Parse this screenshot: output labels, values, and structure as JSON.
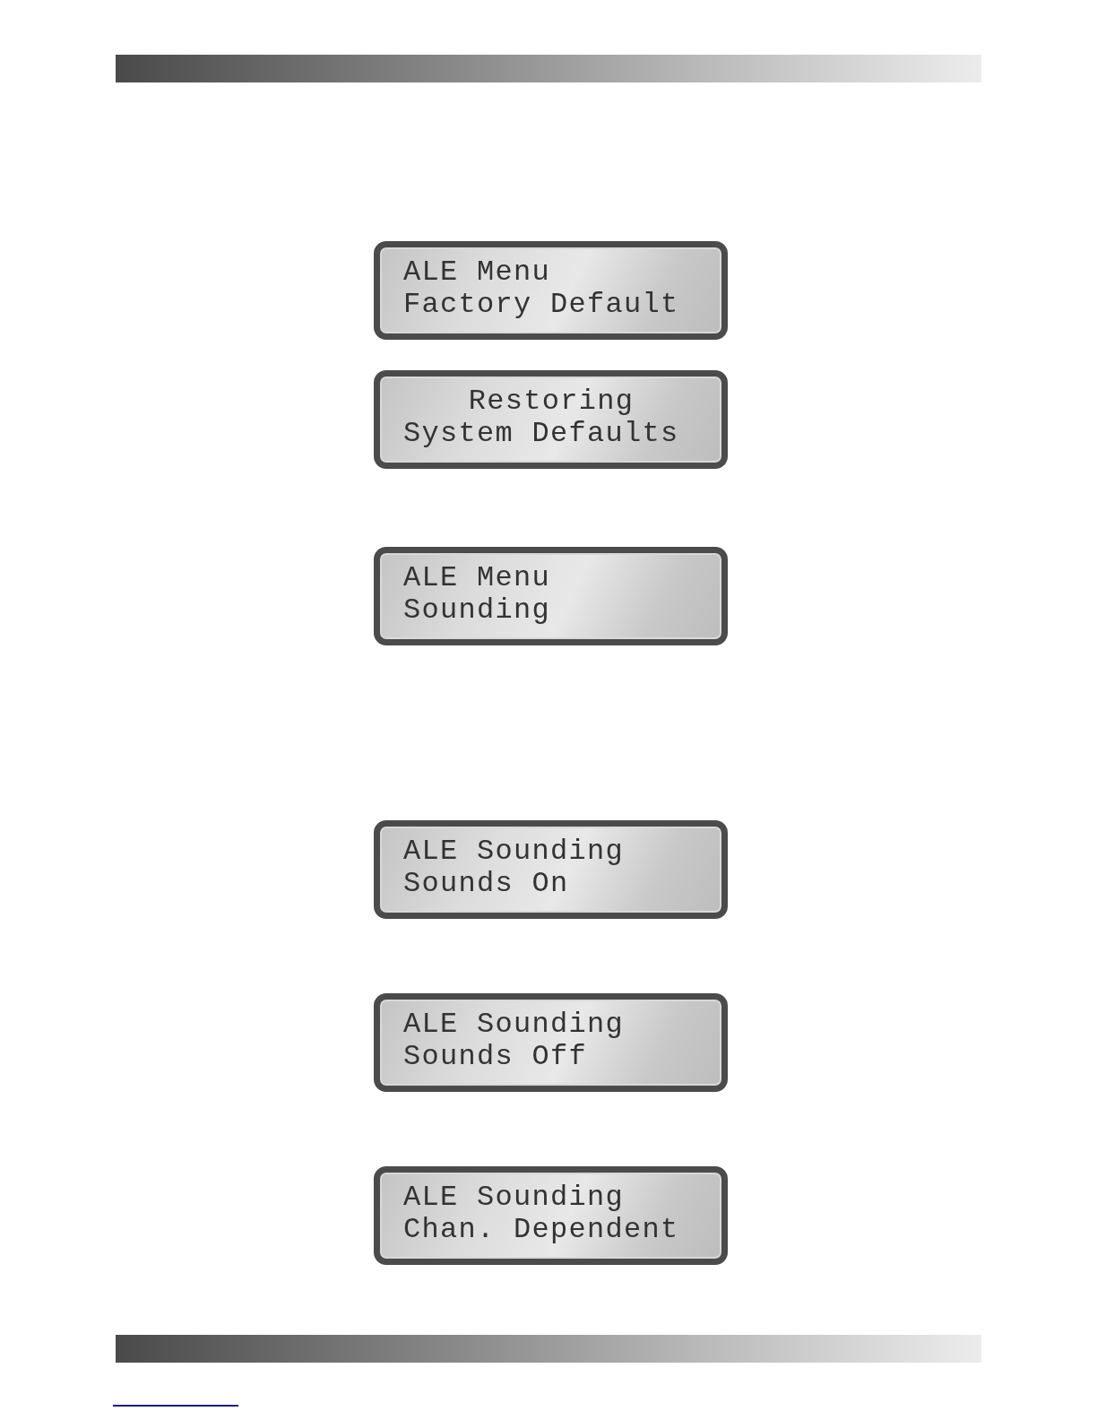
{
  "displays": [
    {
      "lines": [
        {
          "text": "ALE Menu",
          "centered": false
        },
        {
          "text": "Factory Default",
          "centered": false
        }
      ]
    },
    {
      "lines": [
        {
          "text": "Restoring",
          "centered": true
        },
        {
          "text": "System Defaults",
          "centered": false
        }
      ]
    },
    {
      "lines": [
        {
          "text": "ALE Menu",
          "centered": false
        },
        {
          "text": "Sounding",
          "centered": false
        }
      ]
    },
    {
      "lines": [
        {
          "text": "ALE Sounding",
          "centered": false
        },
        {
          "text": "Sounds On",
          "centered": false
        }
      ]
    },
    {
      "lines": [
        {
          "text": "ALE Sounding",
          "centered": false
        },
        {
          "text": "Sounds Off",
          "centered": false
        }
      ]
    },
    {
      "lines": [
        {
          "text": "ALE Sounding",
          "centered": false
        },
        {
          "text": "Chan. Dependent",
          "centered": false
        }
      ]
    }
  ]
}
